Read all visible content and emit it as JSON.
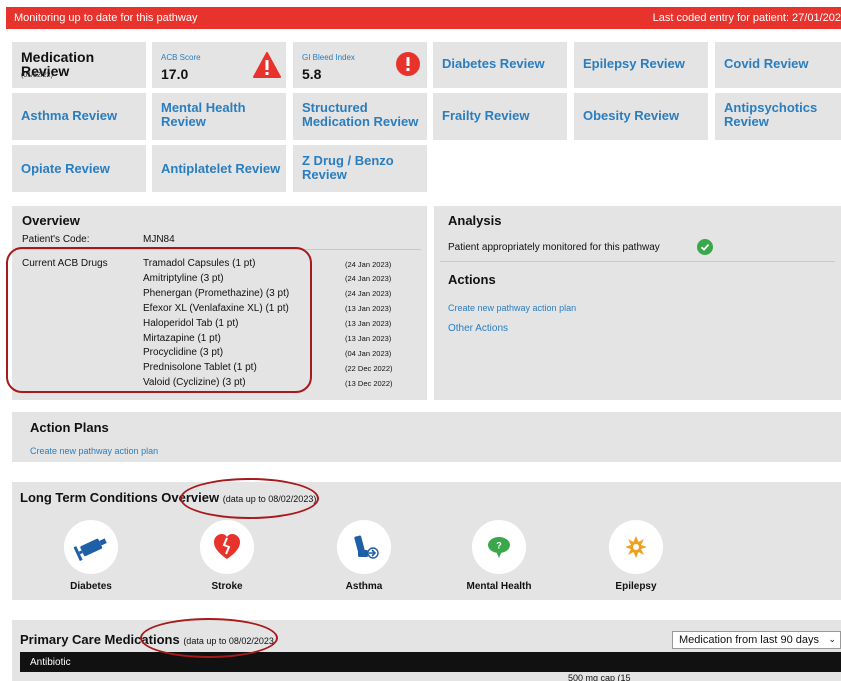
{
  "banner": {
    "status": "Monitoring up to date for this pathway",
    "last_coded": "Last coded entry for patient: 27/01/202"
  },
  "tiles": {
    "medication_review": {
      "title": "Medication Review",
      "date": "(01/12/22)"
    },
    "acb": {
      "label": "ACB Score",
      "value": "17.0"
    },
    "gi": {
      "label": "GI Bleed Index",
      "value": "5.8"
    },
    "reviews": [
      "Diabetes Review",
      "Epilepsy Review",
      "Covid Review",
      "Asthma Review",
      "Mental Health Review",
      "Structured Medication Review",
      "Frailty Review",
      "Obesity Review",
      "Antipsychotics Review",
      "Opiate Review",
      "Antiplatelet Review",
      "Z Drug / Benzo Review"
    ]
  },
  "overview": {
    "title": "Overview",
    "patient_code_label": "Patient's Code:",
    "patient_code": "MJN84",
    "acb_label": "Current ACB Drugs",
    "drugs": [
      {
        "name": "Tramadol Capsules (1 pt)",
        "date": "(24 Jan 2023)"
      },
      {
        "name": "Amitriptyline (3 pt)",
        "date": "(24 Jan 2023)"
      },
      {
        "name": "Phenergan (Promethazine) (3 pt)",
        "date": "(24 Jan 2023)"
      },
      {
        "name": "Efexor XL (Venlafaxine XL) (1 pt)",
        "date": "(13 Jan 2023)"
      },
      {
        "name": "Haloperidol Tab (1 pt)",
        "date": "(13 Jan 2023)"
      },
      {
        "name": "Mirtazapine (1 pt)",
        "date": "(13 Jan 2023)"
      },
      {
        "name": "Procyclidine (3 pt)",
        "date": "(04 Jan 2023)"
      },
      {
        "name": "Prednisolone Tablet (1 pt)",
        "date": "(22 Dec 2022)"
      },
      {
        "name": "Valoid (Cyclizine) (3 pt)",
        "date": "(13 Dec 2022)"
      }
    ]
  },
  "analysis": {
    "title": "Analysis",
    "status": "Patient appropriately monitored for this pathway",
    "actions_title": "Actions",
    "links": [
      "Create new pathway action plan",
      "Other Actions"
    ]
  },
  "action_plans": {
    "title": "Action Plans",
    "link": "Create new pathway action plan"
  },
  "ltc": {
    "title": "Long Term Conditions Overview",
    "note": "(data up to 08/02/2023)",
    "items": [
      {
        "label": "Diabetes",
        "icon": "syringe-icon",
        "color": "#1f5fa8"
      },
      {
        "label": "Stroke",
        "icon": "broken-heart-icon",
        "color": "#e8332c"
      },
      {
        "label": "Asthma",
        "icon": "inhaler-icon",
        "color": "#1f5fa8"
      },
      {
        "label": "Mental Health",
        "icon": "speech-bubble-icon",
        "color": "#3aa84a"
      },
      {
        "label": "Epilepsy",
        "icon": "burst-icon",
        "color": "#f0a020"
      }
    ]
  },
  "pcm": {
    "title": "Primary Care Medications",
    "note": "(data up to 08/02/2023",
    "select": "Medication from last 90 days",
    "category": "Antibiotic",
    "partial_row": "500 mg cap (15"
  },
  "colors": {
    "accent": "#e8332c",
    "link": "#2a7dbf",
    "tile": "#e4e4e4",
    "ok": "#3aa84a",
    "annotation": "#a8191b"
  }
}
